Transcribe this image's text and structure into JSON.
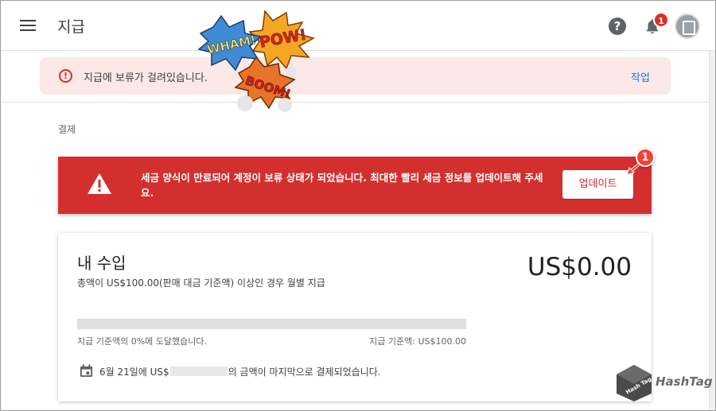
{
  "app": {
    "title": "지급",
    "notification_count": "1"
  },
  "hold_banner": {
    "message": "지급에 보류가 걸려있습니다.",
    "action_label": "작업"
  },
  "section": {
    "label": "결제"
  },
  "tax_alert": {
    "message": "세금 양식이 만료되어 계정이 보류 상태가 되었습니다. 최대한 빨리 세금 정보를 업데이트해 주세요.",
    "button_label": "업데이트",
    "step_badge": "1",
    "color": "#d32f2f"
  },
  "earnings": {
    "title": "내 수입",
    "subtitle": "총액이 US$100.00(판매 대금 기준액) 이상인 경우 월별 지급",
    "amount": "US$0.00",
    "progress_percent": 0,
    "progress_left_label": "지급 기준액의 0%에 도달했습니다.",
    "progress_right_label": "지급 기준액: US$100.00",
    "last_paid_prefix": "6월 21일에 US$",
    "last_paid_suffix": "의 금액이 마지막으로 결제되었습니다."
  },
  "stickers": [
    "WHAM!",
    "POW!",
    "BOOM!"
  ],
  "watermark": {
    "cube_text": "Hash Tag",
    "label": "HashTag"
  },
  "colors": {
    "accent": "#1a73e8",
    "alert_red": "#d32f2f",
    "banner_bg": "#fce8e6"
  }
}
